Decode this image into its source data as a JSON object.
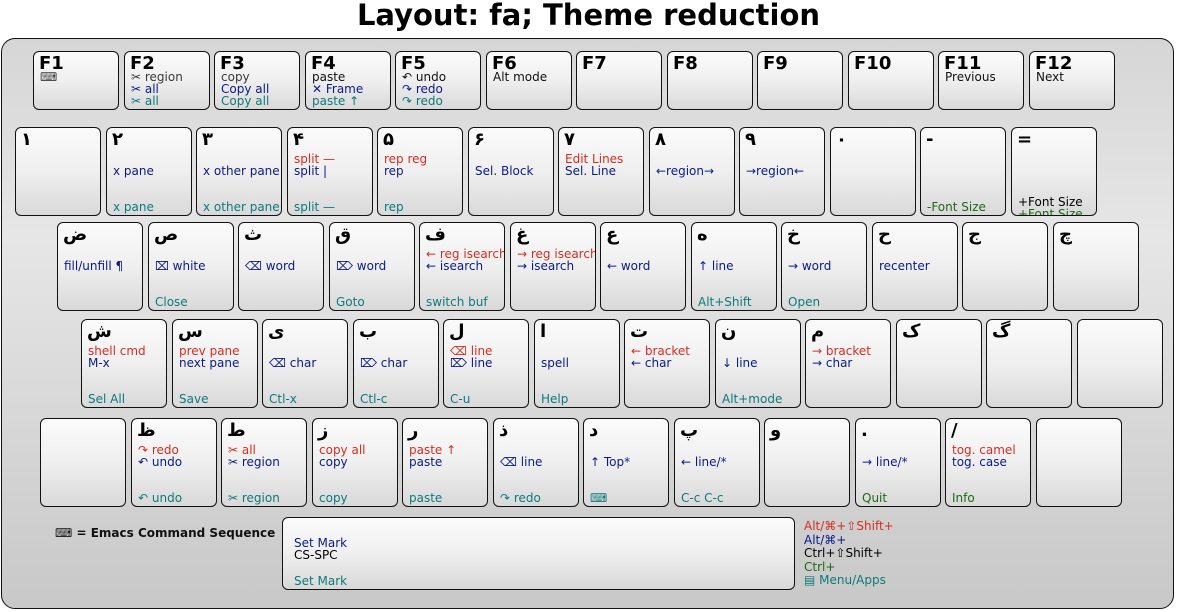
{
  "title": "Layout: fa; Theme reduction",
  "footnote": "⌨ = Emacs Command Sequence",
  "colors": {
    "red": "#d62d20",
    "blue": "#0a1a8a",
    "teal": "#0d7a7a",
    "green": "#1b6a12",
    "magenta": "#e020e0",
    "dark": "#3a3a3a",
    "black": "#111111"
  },
  "modifier_legend": [
    {
      "text": "Alt/⌘+⇧Shift+",
      "color": "red"
    },
    {
      "text": "Alt/⌘+",
      "color": "blue"
    },
    {
      "text": "Ctrl+⇧Shift+",
      "color": "magenta"
    },
    {
      "text": "Ctrl+",
      "color": "green"
    },
    {
      "text": "▤ Menu/Apps",
      "color": "teal"
    }
  ],
  "rows": [
    [
      {
        "label": "F1",
        "lines": [
          {
            "t": "⌨",
            "c": "dark"
          }
        ]
      },
      {
        "label": "F2",
        "lines": [
          {
            "t": "✂ region",
            "c": "dark"
          },
          {
            "t": "✂ all",
            "c": "blue"
          },
          {
            "t": "✂ all",
            "c": "teal"
          }
        ]
      },
      {
        "label": "F3",
        "lines": [
          {
            "t": "copy",
            "c": "dark"
          },
          {
            "t": "Copy all",
            "c": "blue"
          },
          {
            "t": "Copy all",
            "c": "teal"
          }
        ]
      },
      {
        "label": "F4",
        "lines": [
          {
            "t": "paste",
            "c": "black"
          },
          {
            "t": "✕ Frame",
            "c": "blue"
          },
          {
            "t": "paste ↑",
            "c": "teal"
          }
        ]
      },
      {
        "label": "F5",
        "lines": [
          {
            "t": "↶ undo",
            "c": "black"
          },
          {
            "t": "↷ redo",
            "c": "blue"
          },
          {
            "t": "↷ redo",
            "c": "teal"
          }
        ]
      },
      {
        "label": "F6",
        "lines": [
          {
            "t": "Alt mode",
            "c": "black"
          }
        ]
      },
      {
        "label": "F7",
        "lines": []
      },
      {
        "label": "F8",
        "lines": []
      },
      {
        "label": "F9",
        "lines": []
      },
      {
        "label": "F10",
        "lines": []
      },
      {
        "label": "F11",
        "lines": [
          {
            "t": "Previous",
            "c": "black"
          }
        ]
      },
      {
        "label": "F12",
        "lines": [
          {
            "t": "Next",
            "c": "black"
          }
        ]
      }
    ],
    [
      {
        "label": "١",
        "lines": []
      },
      {
        "label": "٢",
        "lines": [
          {
            "t": "",
            "c": "red"
          },
          {
            "t": "x pane",
            "c": "blue"
          },
          {
            "t": "x pane",
            "c": "teal"
          }
        ]
      },
      {
        "label": "٣",
        "lines": [
          {
            "t": "",
            "c": "red"
          },
          {
            "t": "x other pane",
            "c": "blue"
          },
          {
            "t": "x other pane",
            "c": "teal"
          }
        ]
      },
      {
        "label": "۴",
        "lines": [
          {
            "t": "split —",
            "c": "red"
          },
          {
            "t": "split |",
            "c": "blue"
          },
          {
            "t": "split —",
            "c": "teal"
          }
        ]
      },
      {
        "label": "۵",
        "lines": [
          {
            "t": "rep reg",
            "c": "red"
          },
          {
            "t": "rep",
            "c": "blue"
          },
          {
            "t": "rep",
            "c": "teal"
          }
        ]
      },
      {
        "label": "۶",
        "lines": [
          {
            "t": "",
            "c": "red"
          },
          {
            "t": "Sel. Block",
            "c": "blue"
          }
        ]
      },
      {
        "label": "٧",
        "lines": [
          {
            "t": "Edit Lines",
            "c": "red"
          },
          {
            "t": "Sel. Line",
            "c": "blue"
          }
        ]
      },
      {
        "label": "٨",
        "lines": [
          {
            "t": "",
            "c": "red"
          },
          {
            "t": "←region→",
            "c": "blue"
          }
        ]
      },
      {
        "label": "٩",
        "lines": [
          {
            "t": "",
            "c": "red"
          },
          {
            "t": "→region←",
            "c": "blue"
          }
        ]
      },
      {
        "label": "٠",
        "lines": []
      },
      {
        "label": "-",
        "lines": [
          {
            "t": "",
            "c": "red"
          },
          {
            "t": "",
            "c": "blue"
          },
          {
            "t": "-Font Size",
            "c": "green"
          }
        ]
      },
      {
        "label": "=",
        "lines": [
          {
            "t": "",
            "c": "red"
          },
          {
            "t": "",
            "c": "blue"
          },
          {
            "t": "+Font Size",
            "c": "magenta"
          },
          {
            "t": "+Font Size",
            "c": "green"
          }
        ]
      }
    ],
    [
      {
        "label": "ض",
        "lines": [
          {
            "t": "",
            "c": "red"
          },
          {
            "t": "fill/unfill ¶",
            "c": "blue"
          }
        ]
      },
      {
        "label": "ص",
        "lines": [
          {
            "t": "",
            "c": "red"
          },
          {
            "t": "⌧ white",
            "c": "blue"
          },
          {
            "t": "Close",
            "c": "teal"
          }
        ]
      },
      {
        "label": "ث",
        "lines": [
          {
            "t": "",
            "c": "red"
          },
          {
            "t": "⌫ word",
            "c": "blue"
          }
        ]
      },
      {
        "label": "ق",
        "lines": [
          {
            "t": "",
            "c": "red"
          },
          {
            "t": "⌦ word",
            "c": "blue"
          },
          {
            "t": "Goto",
            "c": "teal"
          }
        ]
      },
      {
        "label": "ف",
        "lines": [
          {
            "t": "← reg isearch",
            "c": "red"
          },
          {
            "t": "← isearch",
            "c": "blue"
          },
          {
            "t": "switch buf",
            "c": "teal"
          }
        ]
      },
      {
        "label": "غ",
        "lines": [
          {
            "t": "→ reg isearch",
            "c": "red"
          },
          {
            "t": "→ isearch",
            "c": "blue"
          }
        ]
      },
      {
        "label": "ع",
        "lines": [
          {
            "t": "",
            "c": "red"
          },
          {
            "t": "← word",
            "c": "blue"
          }
        ]
      },
      {
        "label": "ه",
        "lines": [
          {
            "t": "",
            "c": "red"
          },
          {
            "t": "↑ line",
            "c": "blue"
          },
          {
            "t": "Alt+Shift",
            "c": "teal"
          }
        ]
      },
      {
        "label": "خ",
        "lines": [
          {
            "t": "",
            "c": "red"
          },
          {
            "t": "→ word",
            "c": "blue"
          },
          {
            "t": "Open",
            "c": "teal"
          }
        ]
      },
      {
        "label": "ح",
        "lines": [
          {
            "t": "",
            "c": "red"
          },
          {
            "t": "recenter",
            "c": "blue"
          }
        ]
      },
      {
        "label": "ج",
        "lines": []
      },
      {
        "label": "چ",
        "lines": []
      }
    ],
    [
      {
        "label": "ش",
        "lines": [
          {
            "t": "shell cmd",
            "c": "red"
          },
          {
            "t": "M-x",
            "c": "blue"
          },
          {
            "t": "Sel All",
            "c": "teal"
          }
        ]
      },
      {
        "label": "س",
        "lines": [
          {
            "t": "prev pane",
            "c": "red"
          },
          {
            "t": "next pane",
            "c": "blue"
          },
          {
            "t": "Save",
            "c": "teal"
          }
        ]
      },
      {
        "label": "ی",
        "lines": [
          {
            "t": "",
            "c": "red"
          },
          {
            "t": "⌫ char",
            "c": "blue"
          },
          {
            "t": "Ctl-x",
            "c": "teal"
          }
        ]
      },
      {
        "label": "ب",
        "lines": [
          {
            "t": "",
            "c": "red"
          },
          {
            "t": "⌦ char",
            "c": "blue"
          },
          {
            "t": "Ctl-c",
            "c": "teal"
          }
        ]
      },
      {
        "label": "ل",
        "lines": [
          {
            "t": "⌫ line",
            "c": "red"
          },
          {
            "t": "⌦ line",
            "c": "blue"
          },
          {
            "t": "C-u",
            "c": "teal"
          }
        ]
      },
      {
        "label": "ا",
        "lines": [
          {
            "t": "",
            "c": "red"
          },
          {
            "t": "spell",
            "c": "blue"
          },
          {
            "t": "Help",
            "c": "teal"
          }
        ]
      },
      {
        "label": "ت",
        "lines": [
          {
            "t": "← bracket",
            "c": "red"
          },
          {
            "t": "← char",
            "c": "blue"
          }
        ]
      },
      {
        "label": "ن",
        "lines": [
          {
            "t": "",
            "c": "red"
          },
          {
            "t": "↓ line",
            "c": "blue"
          },
          {
            "t": "Alt+mode",
            "c": "teal"
          }
        ]
      },
      {
        "label": "م",
        "lines": [
          {
            "t": "→ bracket",
            "c": "red"
          },
          {
            "t": "→ char",
            "c": "blue"
          }
        ]
      },
      {
        "label": "ک",
        "lines": []
      },
      {
        "label": "گ",
        "lines": []
      },
      {
        "label": "",
        "lines": []
      }
    ],
    [
      {
        "label": "",
        "lines": []
      },
      {
        "label": "ظ",
        "lines": [
          {
            "t": "↷ redo",
            "c": "red"
          },
          {
            "t": "↶ undo",
            "c": "blue"
          },
          {
            "t": "↶ undo",
            "c": "teal"
          }
        ]
      },
      {
        "label": "ط",
        "lines": [
          {
            "t": "✂ all",
            "c": "red"
          },
          {
            "t": "✂ region",
            "c": "blue"
          },
          {
            "t": "✂ region",
            "c": "teal"
          }
        ]
      },
      {
        "label": "ز",
        "lines": [
          {
            "t": "copy all",
            "c": "red"
          },
          {
            "t": "copy",
            "c": "blue"
          },
          {
            "t": "copy",
            "c": "teal"
          }
        ]
      },
      {
        "label": "ر",
        "lines": [
          {
            "t": "paste ↑",
            "c": "red"
          },
          {
            "t": "paste",
            "c": "blue"
          },
          {
            "t": "paste",
            "c": "teal"
          }
        ]
      },
      {
        "label": "ذ",
        "lines": [
          {
            "t": "",
            "c": "red"
          },
          {
            "t": "⌫ line",
            "c": "blue"
          },
          {
            "t": "↷ redo",
            "c": "teal"
          }
        ]
      },
      {
        "label": "د",
        "lines": [
          {
            "t": "",
            "c": "red"
          },
          {
            "t": "↑ Top*",
            "c": "blue"
          },
          {
            "t": "⌨",
            "c": "teal"
          }
        ]
      },
      {
        "label": "پ",
        "lines": [
          {
            "t": "",
            "c": "red"
          },
          {
            "t": "← line/*",
            "c": "blue"
          },
          {
            "t": "C-c C-c",
            "c": "teal"
          }
        ]
      },
      {
        "label": "و",
        "lines": []
      },
      {
        "label": ".",
        "lines": [
          {
            "t": "",
            "c": "red"
          },
          {
            "t": "→ line/*",
            "c": "blue"
          },
          {
            "t": "Quit",
            "c": "green"
          }
        ]
      },
      {
        "label": "/",
        "lines": [
          {
            "t": "tog. camel",
            "c": "red"
          },
          {
            "t": "tog. case",
            "c": "blue"
          },
          {
            "t": "Info",
            "c": "green"
          }
        ]
      },
      {
        "label": "",
        "lines": []
      }
    ]
  ],
  "spacebar": {
    "label": "",
    "lines": [
      {
        "t": "Set Mark",
        "c": "blue"
      },
      {
        "t": "CS-SPC",
        "c": "magenta"
      },
      {
        "t": "Set Mark",
        "c": "teal"
      }
    ]
  }
}
